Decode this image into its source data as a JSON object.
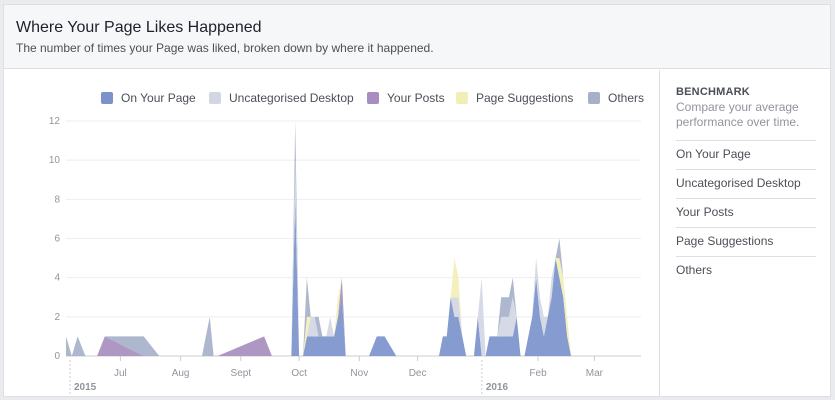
{
  "header": {
    "title": "Where Your Page Likes Happened",
    "subtitle": "The number of times your Page was liked, broken down by where it happened."
  },
  "benchmark": {
    "title": "BENCHMARK",
    "description": "Compare your average performance over time.",
    "items": [
      "On Your Page",
      "Uncategorised Desktop",
      "Your Posts",
      "Page Suggestions",
      "Others"
    ]
  },
  "chart_data": {
    "type": "area",
    "stacked": true,
    "legend_position": "top",
    "grid": true,
    "ylim": [
      0,
      12
    ],
    "yticks": [
      0,
      2,
      4,
      6,
      8,
      10,
      12
    ],
    "xticks": [
      {
        "label": "Jul",
        "x": 28
      },
      {
        "label": "Aug",
        "x": 59
      },
      {
        "label": "Sept",
        "x": 90
      },
      {
        "label": "Oct",
        "x": 120
      },
      {
        "label": "Nov",
        "x": 151
      },
      {
        "label": "Dec",
        "x": 181
      },
      {
        "label": "Feb",
        "x": 243
      },
      {
        "label": "Mar",
        "x": 272
      }
    ],
    "year_labels": [
      {
        "label": "2015",
        "x": 0
      },
      {
        "label": "2016",
        "x": 212
      }
    ],
    "x_domain": [
      0,
      296
    ],
    "x": [
      0,
      3,
      6,
      10,
      13,
      16,
      20,
      40,
      48,
      50,
      52,
      70,
      74,
      76,
      78,
      102,
      106,
      108,
      110,
      112,
      114,
      116,
      118,
      120,
      122,
      124,
      126,
      128,
      130,
      132,
      134,
      136,
      138,
      140,
      142,
      144,
      146,
      148,
      150,
      152,
      156,
      160,
      164,
      170,
      178,
      184,
      190,
      192,
      194,
      196,
      198,
      200,
      202,
      204,
      206,
      208,
      210,
      212,
      214,
      216,
      218,
      220,
      222,
      224,
      226,
      228,
      230,
      232,
      234,
      236,
      238,
      240,
      242,
      244,
      246,
      248,
      250,
      252,
      254,
      256,
      258,
      260,
      262,
      264,
      266,
      268,
      270
    ],
    "series": [
      {
        "name": "On Your Page",
        "color": "#7c92cb",
        "values": [
          0,
          0,
          0,
          0,
          0,
          0,
          0,
          0,
          0,
          0,
          0,
          0,
          0,
          0,
          0,
          0,
          0,
          0,
          0,
          0,
          0,
          0,
          8,
          0,
          0,
          1,
          1,
          1,
          1,
          1,
          1,
          1,
          1,
          2,
          3,
          0,
          0,
          0,
          0,
          0,
          0,
          1,
          1,
          0,
          0,
          0,
          0,
          0,
          1,
          1,
          3,
          2,
          2,
          1,
          0,
          0,
          0,
          2,
          0,
          0,
          1,
          1,
          1,
          1,
          1,
          1,
          1,
          2,
          0,
          0,
          1,
          2,
          4,
          2,
          1,
          2,
          3,
          5,
          4,
          3,
          1,
          0,
          0,
          0,
          0,
          0,
          0
        ]
      },
      {
        "name": "Uncategorised Desktop",
        "color": "#d2d7e4",
        "values": [
          0,
          0,
          0,
          0,
          0,
          0,
          0,
          0,
          0,
          0,
          0,
          0,
          0,
          0,
          0,
          0,
          0,
          0,
          0,
          0,
          0,
          0,
          2,
          0,
          0,
          0,
          1,
          1,
          0,
          0,
          0,
          1,
          0,
          0,
          0,
          0,
          0,
          0,
          0,
          0,
          0,
          0,
          0,
          0,
          0,
          0,
          0,
          0,
          0,
          0,
          0,
          1,
          1,
          0,
          0,
          0,
          0,
          0,
          4,
          0,
          0,
          0,
          0,
          1,
          1,
          1,
          2,
          0,
          0,
          0,
          0,
          0,
          1,
          1,
          1,
          0,
          1,
          0,
          0,
          0,
          0,
          0,
          0,
          0,
          0,
          0,
          0
        ]
      },
      {
        "name": "Your Posts",
        "color": "#a88ebe",
        "values": [
          0,
          0,
          0,
          0,
          0,
          0,
          1,
          0,
          0,
          0,
          0,
          0,
          0,
          0,
          0,
          1,
          0,
          0,
          0,
          0,
          0,
          0,
          0,
          0,
          0,
          0,
          0,
          0,
          0,
          0,
          0,
          0,
          0,
          0,
          1,
          0,
          0,
          0,
          0,
          0,
          0,
          0,
          0,
          0,
          0,
          0,
          0,
          0,
          0,
          0,
          0,
          0,
          0,
          0,
          0,
          0,
          0,
          0,
          0,
          0,
          0,
          0,
          0,
          0,
          0,
          0,
          0,
          0,
          0,
          0,
          0,
          0,
          0,
          0,
          0,
          0,
          0,
          0,
          0,
          0,
          0,
          0,
          0,
          0,
          0,
          0,
          0
        ]
      },
      {
        "name": "Page Suggestions",
        "color": "#f2efb6",
        "values": [
          0,
          0,
          0,
          0,
          0,
          0,
          0,
          0,
          0,
          0,
          0,
          0,
          0,
          0,
          0,
          0,
          0,
          0,
          0,
          0,
          0,
          0,
          0,
          0,
          0,
          1,
          0,
          0,
          0,
          0,
          0,
          0,
          0,
          1,
          0,
          0,
          0,
          0,
          0,
          0,
          0,
          0,
          0,
          0,
          0,
          0,
          0,
          0,
          0,
          0,
          0,
          2,
          1,
          0,
          0,
          0,
          0,
          0,
          0,
          0,
          0,
          0,
          0,
          0,
          0,
          0,
          0,
          0,
          0,
          0,
          0,
          0,
          0,
          0,
          0,
          0,
          0,
          0,
          1,
          1,
          1,
          0,
          0,
          0,
          0,
          0,
          0
        ]
      },
      {
        "name": "Others",
        "color": "#a6b1c9",
        "values": [
          1,
          0,
          1,
          0,
          0,
          0,
          0,
          1,
          0,
          0,
          0,
          0,
          2,
          0,
          0,
          0,
          0,
          0,
          0,
          0,
          0,
          0,
          2,
          0,
          0,
          2,
          0,
          0,
          1,
          0,
          0,
          0,
          0,
          0,
          0,
          0,
          0,
          0,
          0,
          0,
          0,
          0,
          0,
          0,
          0,
          0,
          0,
          0,
          0,
          0,
          0,
          0,
          0,
          0,
          0,
          0,
          0,
          0,
          0,
          0,
          0,
          0,
          0,
          1,
          1,
          1,
          1,
          0,
          0,
          0,
          0,
          0,
          0,
          0,
          0,
          0,
          0,
          0,
          1,
          0,
          0,
          0,
          0,
          0,
          0,
          0,
          0
        ]
      }
    ]
  }
}
